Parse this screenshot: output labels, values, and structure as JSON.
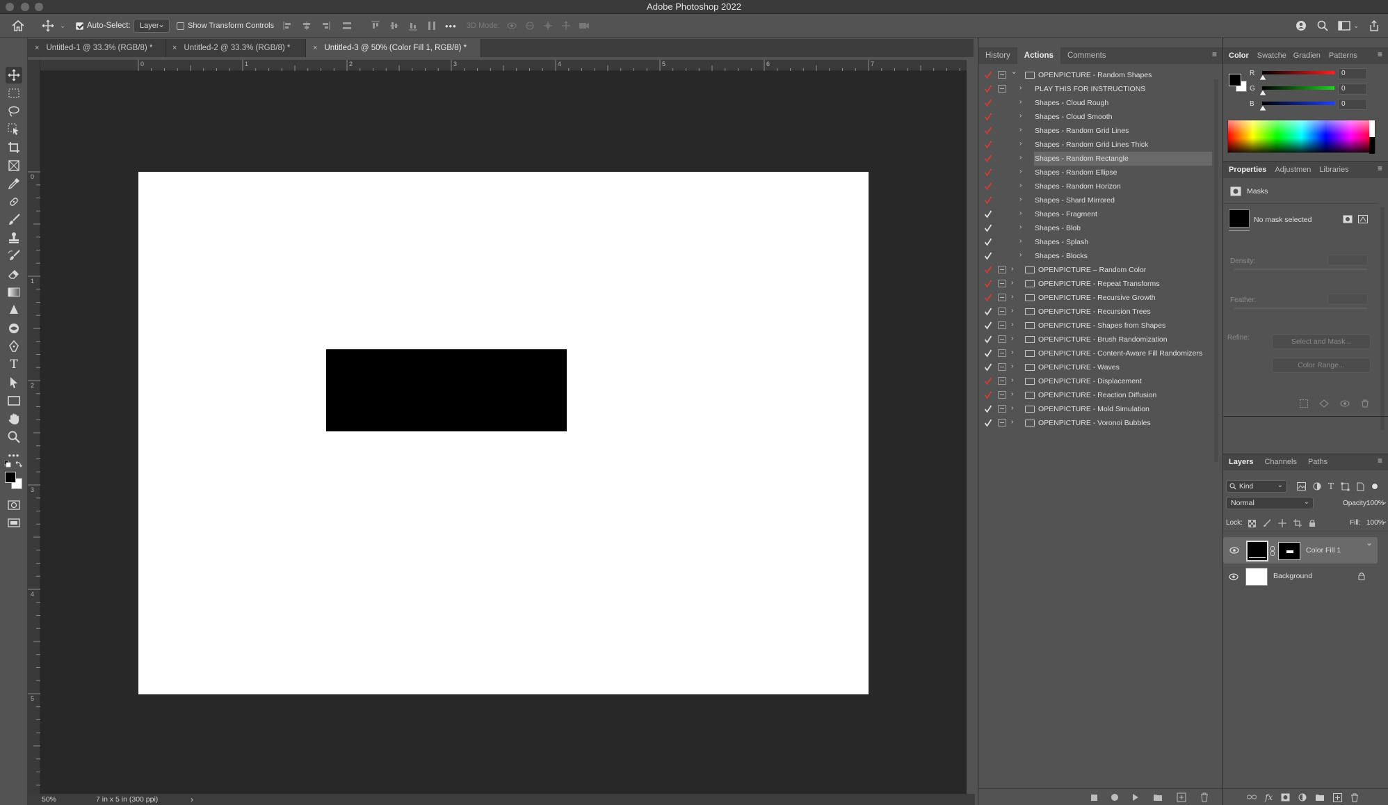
{
  "app": {
    "window_title": "Adobe Photoshop 2022"
  },
  "options_bar": {
    "auto_select_label": "Auto-Select:",
    "auto_select_checked": true,
    "auto_select_target": "Layer",
    "show_transform_label": "Show Transform Controls",
    "show_transform_checked": false,
    "mode_3d_label": "3D Mode:",
    "more_label": "•••"
  },
  "doc_tabs": [
    {
      "label": "Untitled-1 @ 33.3% (RGB/8) *",
      "active": false
    },
    {
      "label": "Untitled-2 @ 33.3% (RGB/8) *",
      "active": false
    },
    {
      "label": "Untitled-3 @ 50% (Color Fill 1, RGB/8) *",
      "active": true
    }
  ],
  "rulers": {
    "horizontal": [
      "0",
      "1",
      "2",
      "3",
      "4",
      "5",
      "6",
      "7"
    ],
    "vertical": [
      "0",
      "1",
      "2",
      "3",
      "4",
      "5"
    ]
  },
  "status_bar": {
    "zoom": "50%",
    "doc_info": "7 in x 5 in (300 ppi)",
    "arrow": "›"
  },
  "tools": [
    "move-icon",
    "marquee-icon",
    "lasso-icon",
    "object-select-icon",
    "crop-icon",
    "frame-icon",
    "eyedropper-icon",
    "healing-icon",
    "brush-icon",
    "stamp-icon",
    "history-brush-icon",
    "eraser-icon",
    "gradient-icon",
    "blur-icon",
    "dodge-icon",
    "pen-icon",
    "type-icon",
    "path-select-icon",
    "rectangle-icon",
    "hand-icon",
    "zoom-icon",
    "more-tools-icon"
  ],
  "actions_panel": {
    "tabs": [
      {
        "label": "History",
        "active": false
      },
      {
        "label": "Actions",
        "active": true
      },
      {
        "label": "Comments",
        "active": false
      }
    ],
    "items": [
      {
        "label": "OPENPICTURE - Random Shapes",
        "level": 0,
        "expanded": true,
        "check_color": "#d93a3a",
        "dialog": true,
        "highlighted": false
      },
      {
        "label": "PLAY THIS FOR INSTRUCTIONS",
        "level": 1,
        "check_color": "#d93a3a",
        "dialog": true,
        "highlighted": false
      },
      {
        "label": "Shapes - Cloud Rough",
        "level": 1,
        "check_color": "#d93a3a",
        "dialog": false,
        "highlighted": false
      },
      {
        "label": "Shapes - Cloud Smooth",
        "level": 1,
        "check_color": "#d93a3a",
        "dialog": false,
        "highlighted": false
      },
      {
        "label": "Shapes - Random Grid Lines",
        "level": 1,
        "check_color": "#d93a3a",
        "dialog": false,
        "highlighted": false
      },
      {
        "label": "Shapes - Random Grid Lines Thick",
        "level": 1,
        "check_color": "#d93a3a",
        "dialog": false,
        "highlighted": false
      },
      {
        "label": "Shapes - Random Rectangle",
        "level": 1,
        "check_color": "#d93a3a",
        "dialog": false,
        "highlighted": true
      },
      {
        "label": "Shapes - Random Ellipse",
        "level": 1,
        "check_color": "#d93a3a",
        "dialog": false,
        "highlighted": false
      },
      {
        "label": "Shapes - Random Horizon",
        "level": 1,
        "check_color": "#d93a3a",
        "dialog": false,
        "highlighted": false
      },
      {
        "label": "Shapes - Shard Mirrored",
        "level": 1,
        "check_color": "#d93a3a",
        "dialog": false,
        "highlighted": false
      },
      {
        "label": "Shapes - Fragment",
        "level": 1,
        "check_color": "#e0e0e0",
        "dialog": false,
        "highlighted": false
      },
      {
        "label": "Shapes - Blob",
        "level": 1,
        "check_color": "#e0e0e0",
        "dialog": false,
        "highlighted": false
      },
      {
        "label": "Shapes - Splash",
        "level": 1,
        "check_color": "#e0e0e0",
        "dialog": false,
        "highlighted": false
      },
      {
        "label": "Shapes - Blocks",
        "level": 1,
        "check_color": "#e0e0e0",
        "dialog": false,
        "highlighted": false
      },
      {
        "label": "OPENPICTURE – Random Color",
        "level": 0,
        "expanded": false,
        "check_color": "#d93a3a",
        "dialog": true,
        "highlighted": false
      },
      {
        "label": "OPENPICTURE - Repeat Transforms",
        "level": 0,
        "expanded": false,
        "check_color": "#d93a3a",
        "dialog": true,
        "highlighted": false
      },
      {
        "label": "OPENPICTURE - Recursive Growth",
        "level": 0,
        "expanded": false,
        "check_color": "#d93a3a",
        "dialog": true,
        "highlighted": false
      },
      {
        "label": "OPENPICTURE - Recursion Trees",
        "level": 0,
        "expanded": false,
        "check_color": "#e0e0e0",
        "dialog": true,
        "highlighted": false
      },
      {
        "label": "OPENPICTURE - Shapes from Shapes",
        "level": 0,
        "expanded": false,
        "check_color": "#e0e0e0",
        "dialog": true,
        "highlighted": false
      },
      {
        "label": "OPENPICTURE - Brush Randomization",
        "level": 0,
        "expanded": false,
        "check_color": "#e0e0e0",
        "dialog": true,
        "highlighted": false
      },
      {
        "label": "OPENPICTURE - Content-Aware Fill Randomizers",
        "level": 0,
        "expanded": false,
        "check_color": "#e0e0e0",
        "dialog": true,
        "highlighted": false
      },
      {
        "label": "OPENPICTURE - Waves",
        "level": 0,
        "expanded": false,
        "check_color": "#e0e0e0",
        "dialog": true,
        "highlighted": false
      },
      {
        "label": "OPENPICTURE - Displacement",
        "level": 0,
        "expanded": false,
        "check_color": "#d93a3a",
        "dialog": true,
        "highlighted": false
      },
      {
        "label": "OPENPICTURE - Reaction Diffusion",
        "level": 0,
        "expanded": false,
        "check_color": "#d93a3a",
        "dialog": true,
        "highlighted": false
      },
      {
        "label": "OPENPICTURE - Mold Simulation",
        "level": 0,
        "expanded": false,
        "check_color": "#e0e0e0",
        "dialog": true,
        "highlighted": false
      },
      {
        "label": "OPENPICTURE - Voronoi Bubbles",
        "level": 0,
        "expanded": false,
        "check_color": "#e0e0e0",
        "dialog": true,
        "highlighted": false
      }
    ]
  },
  "color_panel": {
    "tabs": [
      {
        "label": "Color",
        "active": true
      },
      {
        "label": "Swatche",
        "active": false
      },
      {
        "label": "Gradien",
        "active": false
      },
      {
        "label": "Patterns",
        "active": false
      }
    ],
    "channels": [
      {
        "label": "R",
        "value": "0",
        "color": "#ff2020"
      },
      {
        "label": "G",
        "value": "0",
        "color": "#20d020"
      },
      {
        "label": "B",
        "value": "0",
        "color": "#2040ff"
      }
    ]
  },
  "properties_panel": {
    "tabs": [
      {
        "label": "Properties",
        "active": true
      },
      {
        "label": "Adjustmen",
        "active": false
      },
      {
        "label": "Libraries",
        "active": false
      }
    ],
    "section": "Masks",
    "mask_status": "No mask selected",
    "density_label": "Density:",
    "feather_label": "Feather:",
    "refine_label": "Refine:",
    "select_mask_button": "Select and Mask...",
    "color_range_button": "Color Range..."
  },
  "layers_panel": {
    "tabs": [
      {
        "label": "Layers",
        "active": true
      },
      {
        "label": "Channels",
        "active": false
      },
      {
        "label": "Paths",
        "active": false
      }
    ],
    "filter_kind": "Kind",
    "blend_mode": "Normal",
    "opacity_label": "Opacity:",
    "opacity_value": "100%",
    "lock_label": "Lock:",
    "fill_label": "Fill:",
    "fill_value": "100%",
    "layers": [
      {
        "name": "Color Fill 1",
        "selected": true
      },
      {
        "name": "Background",
        "selected": false,
        "locked": true
      }
    ]
  }
}
